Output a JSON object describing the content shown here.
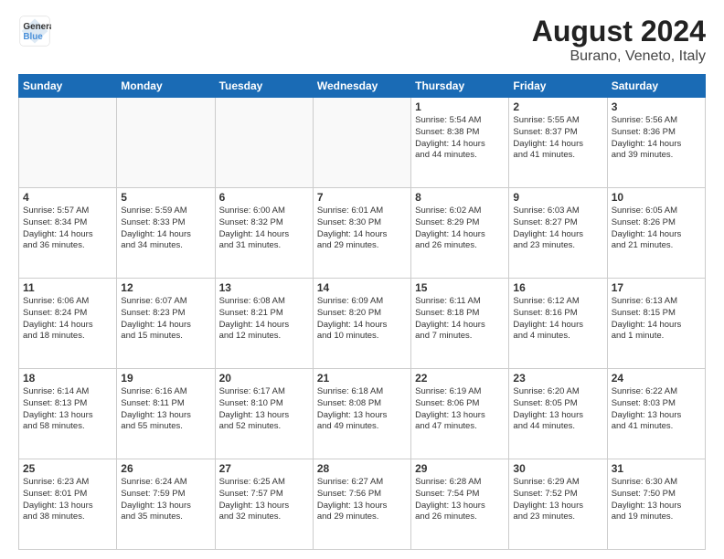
{
  "logo": {
    "line1": "General",
    "line2": "Blue"
  },
  "title": "August 2024",
  "subtitle": "Burano, Veneto, Italy",
  "days_of_week": [
    "Sunday",
    "Monday",
    "Tuesday",
    "Wednesday",
    "Thursday",
    "Friday",
    "Saturday"
  ],
  "weeks": [
    [
      {
        "day": "",
        "info": ""
      },
      {
        "day": "",
        "info": ""
      },
      {
        "day": "",
        "info": ""
      },
      {
        "day": "",
        "info": ""
      },
      {
        "day": "1",
        "info": "Sunrise: 5:54 AM\nSunset: 8:38 PM\nDaylight: 14 hours\nand 44 minutes."
      },
      {
        "day": "2",
        "info": "Sunrise: 5:55 AM\nSunset: 8:37 PM\nDaylight: 14 hours\nand 41 minutes."
      },
      {
        "day": "3",
        "info": "Sunrise: 5:56 AM\nSunset: 8:36 PM\nDaylight: 14 hours\nand 39 minutes."
      }
    ],
    [
      {
        "day": "4",
        "info": "Sunrise: 5:57 AM\nSunset: 8:34 PM\nDaylight: 14 hours\nand 36 minutes."
      },
      {
        "day": "5",
        "info": "Sunrise: 5:59 AM\nSunset: 8:33 PM\nDaylight: 14 hours\nand 34 minutes."
      },
      {
        "day": "6",
        "info": "Sunrise: 6:00 AM\nSunset: 8:32 PM\nDaylight: 14 hours\nand 31 minutes."
      },
      {
        "day": "7",
        "info": "Sunrise: 6:01 AM\nSunset: 8:30 PM\nDaylight: 14 hours\nand 29 minutes."
      },
      {
        "day": "8",
        "info": "Sunrise: 6:02 AM\nSunset: 8:29 PM\nDaylight: 14 hours\nand 26 minutes."
      },
      {
        "day": "9",
        "info": "Sunrise: 6:03 AM\nSunset: 8:27 PM\nDaylight: 14 hours\nand 23 minutes."
      },
      {
        "day": "10",
        "info": "Sunrise: 6:05 AM\nSunset: 8:26 PM\nDaylight: 14 hours\nand 21 minutes."
      }
    ],
    [
      {
        "day": "11",
        "info": "Sunrise: 6:06 AM\nSunset: 8:24 PM\nDaylight: 14 hours\nand 18 minutes."
      },
      {
        "day": "12",
        "info": "Sunrise: 6:07 AM\nSunset: 8:23 PM\nDaylight: 14 hours\nand 15 minutes."
      },
      {
        "day": "13",
        "info": "Sunrise: 6:08 AM\nSunset: 8:21 PM\nDaylight: 14 hours\nand 12 minutes."
      },
      {
        "day": "14",
        "info": "Sunrise: 6:09 AM\nSunset: 8:20 PM\nDaylight: 14 hours\nand 10 minutes."
      },
      {
        "day": "15",
        "info": "Sunrise: 6:11 AM\nSunset: 8:18 PM\nDaylight: 14 hours\nand 7 minutes."
      },
      {
        "day": "16",
        "info": "Sunrise: 6:12 AM\nSunset: 8:16 PM\nDaylight: 14 hours\nand 4 minutes."
      },
      {
        "day": "17",
        "info": "Sunrise: 6:13 AM\nSunset: 8:15 PM\nDaylight: 14 hours\nand 1 minute."
      }
    ],
    [
      {
        "day": "18",
        "info": "Sunrise: 6:14 AM\nSunset: 8:13 PM\nDaylight: 13 hours\nand 58 minutes."
      },
      {
        "day": "19",
        "info": "Sunrise: 6:16 AM\nSunset: 8:11 PM\nDaylight: 13 hours\nand 55 minutes."
      },
      {
        "day": "20",
        "info": "Sunrise: 6:17 AM\nSunset: 8:10 PM\nDaylight: 13 hours\nand 52 minutes."
      },
      {
        "day": "21",
        "info": "Sunrise: 6:18 AM\nSunset: 8:08 PM\nDaylight: 13 hours\nand 49 minutes."
      },
      {
        "day": "22",
        "info": "Sunrise: 6:19 AM\nSunset: 8:06 PM\nDaylight: 13 hours\nand 47 minutes."
      },
      {
        "day": "23",
        "info": "Sunrise: 6:20 AM\nSunset: 8:05 PM\nDaylight: 13 hours\nand 44 minutes."
      },
      {
        "day": "24",
        "info": "Sunrise: 6:22 AM\nSunset: 8:03 PM\nDaylight: 13 hours\nand 41 minutes."
      }
    ],
    [
      {
        "day": "25",
        "info": "Sunrise: 6:23 AM\nSunset: 8:01 PM\nDaylight: 13 hours\nand 38 minutes."
      },
      {
        "day": "26",
        "info": "Sunrise: 6:24 AM\nSunset: 7:59 PM\nDaylight: 13 hours\nand 35 minutes."
      },
      {
        "day": "27",
        "info": "Sunrise: 6:25 AM\nSunset: 7:57 PM\nDaylight: 13 hours\nand 32 minutes."
      },
      {
        "day": "28",
        "info": "Sunrise: 6:27 AM\nSunset: 7:56 PM\nDaylight: 13 hours\nand 29 minutes."
      },
      {
        "day": "29",
        "info": "Sunrise: 6:28 AM\nSunset: 7:54 PM\nDaylight: 13 hours\nand 26 minutes."
      },
      {
        "day": "30",
        "info": "Sunrise: 6:29 AM\nSunset: 7:52 PM\nDaylight: 13 hours\nand 23 minutes."
      },
      {
        "day": "31",
        "info": "Sunrise: 6:30 AM\nSunset: 7:50 PM\nDaylight: 13 hours\nand 19 minutes."
      }
    ]
  ]
}
